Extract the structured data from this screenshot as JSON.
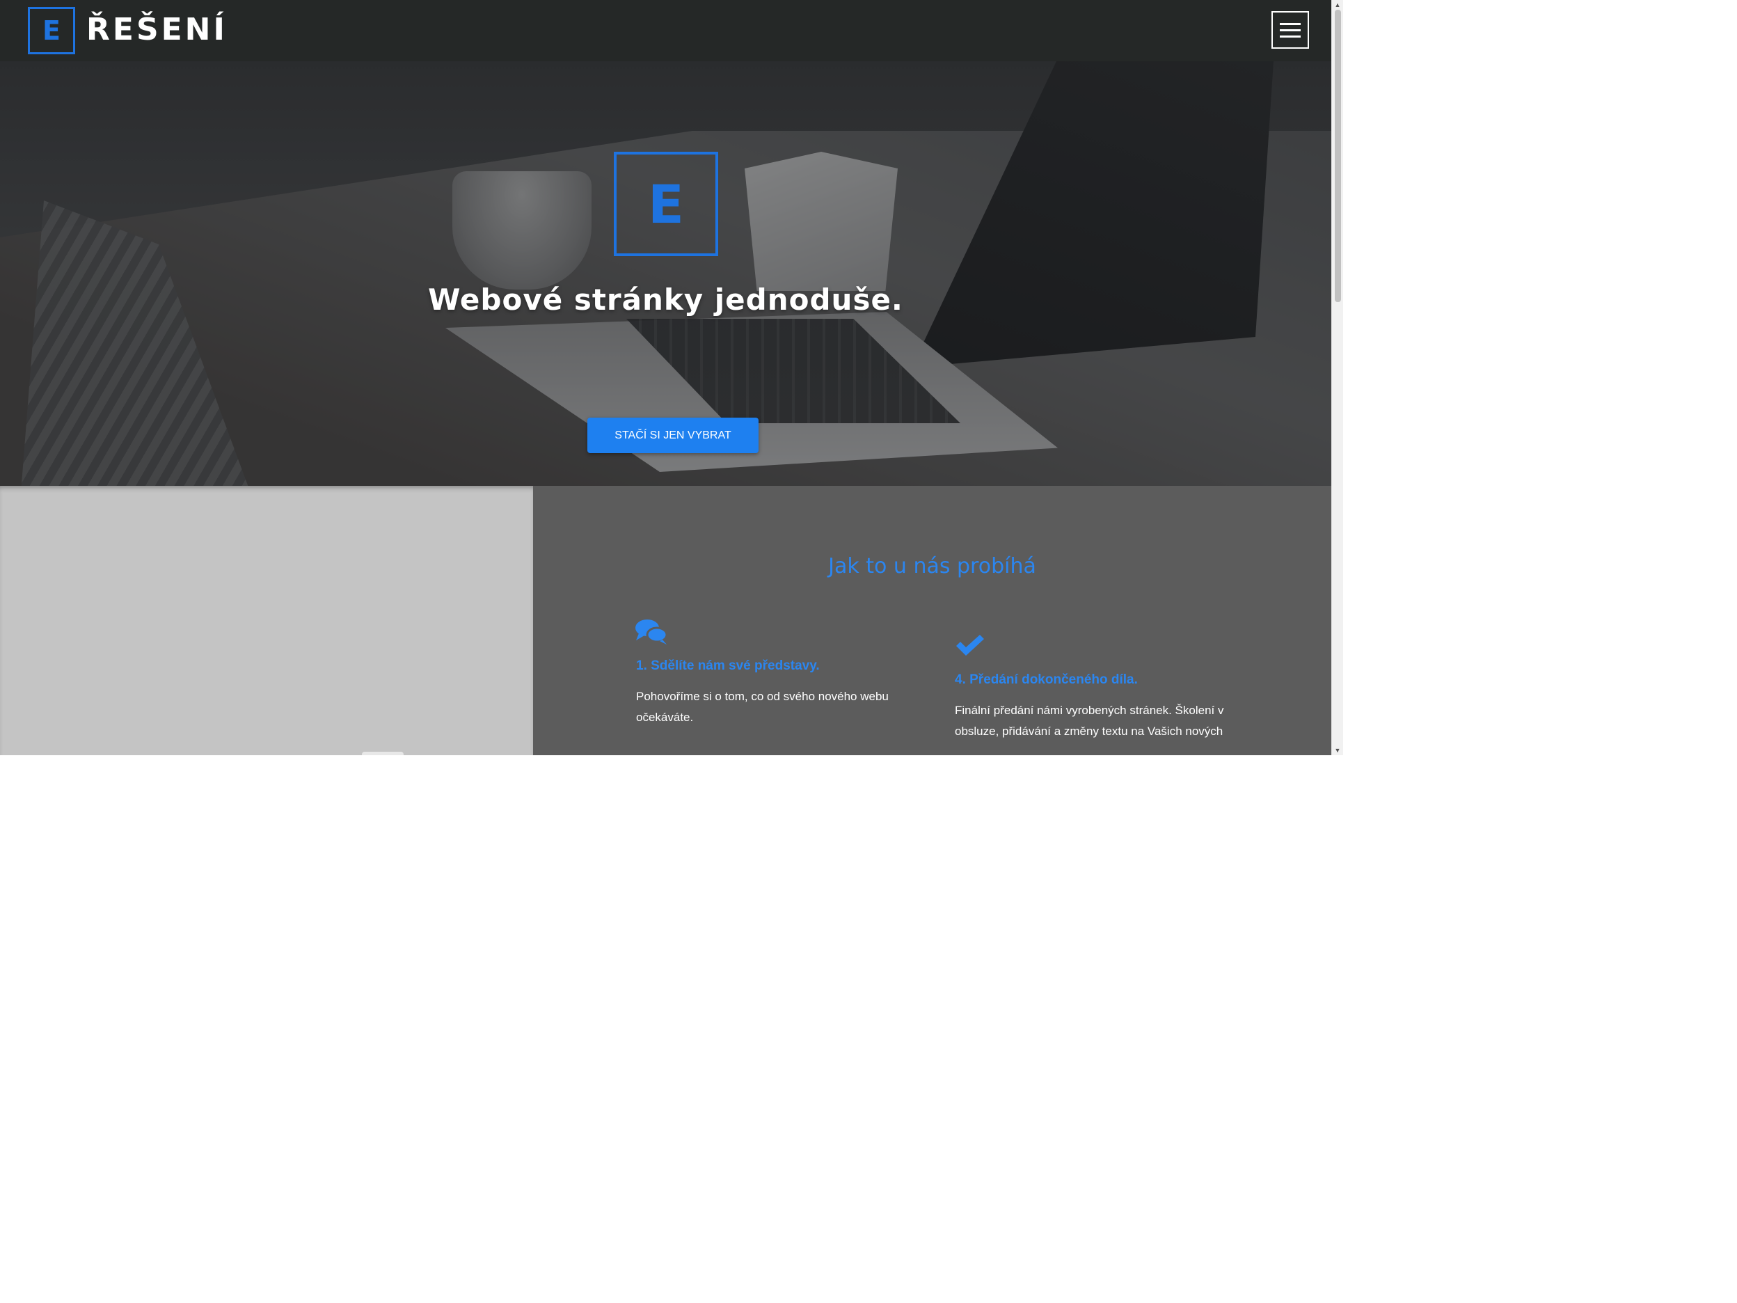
{
  "navbar": {
    "logo_letter": "E",
    "brand_name": "ŘEŠENÍ"
  },
  "hero": {
    "logo_letter": "E",
    "title": "Webové stránky jednoduše.",
    "cta_label": "STAČÍ SI JEN VYBRAT"
  },
  "process": {
    "title": "Jak to u nás probíhá",
    "steps": [
      {
        "icon": "comments-icon",
        "title": "1. Sdělíte nám své představy.",
        "text": "Pohovoříme si o tom, co od svého nového webu očekáváte."
      },
      {
        "icon": "check-icon",
        "title": "4. Předání dokončeného díla.",
        "text": "Finální předání námi vyrobených stránek. Školení v obsluze, přidávání a změny textu na Vašich nových"
      }
    ]
  },
  "colors": {
    "accent": "#1e73e0",
    "cta": "#1e80f0",
    "navbar": "#252827",
    "process_panel": "#5c5c5c",
    "image_panel": "#c4c4c4"
  }
}
